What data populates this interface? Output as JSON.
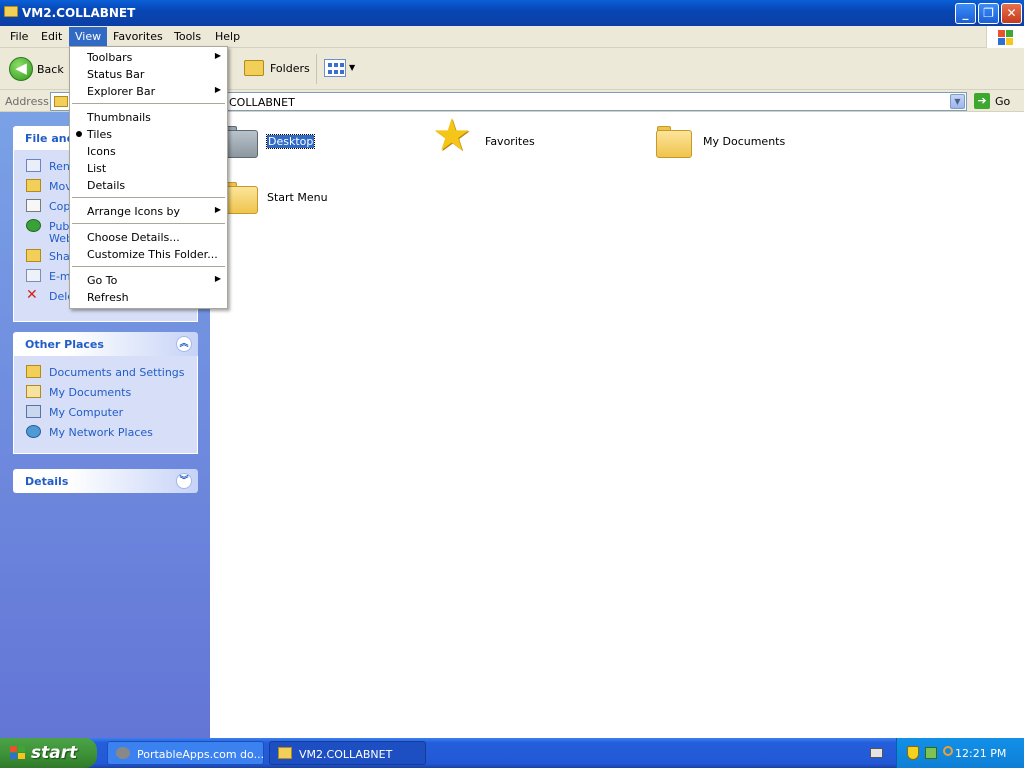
{
  "window": {
    "title": "VM2.COLLABNET",
    "controls": {
      "minimize": "_",
      "maximize": "❐",
      "close": "✕"
    }
  },
  "menubar": {
    "items": [
      "File",
      "Edit",
      "View",
      "Favorites",
      "Tools",
      "Help"
    ],
    "active": "View"
  },
  "toolbar": {
    "back_label": "Back",
    "folders_label": "Folders"
  },
  "address": {
    "label": "Address",
    "value": "COLLABNET",
    "go_label": "Go"
  },
  "view_menu": {
    "items": [
      {
        "label": "Toolbars",
        "submenu": true
      },
      {
        "label": "Status Bar"
      },
      {
        "label": "Explorer Bar",
        "submenu": true
      },
      {
        "label": "Thumbnails"
      },
      {
        "label": "Tiles",
        "checked": true
      },
      {
        "label": "Icons"
      },
      {
        "label": "List"
      },
      {
        "label": "Details"
      },
      {
        "label": "Arrange Icons by",
        "submenu": true
      },
      {
        "label": "Choose Details..."
      },
      {
        "label": "Customize This Folder..."
      },
      {
        "label": "Go To",
        "submenu": true
      },
      {
        "label": "Refresh"
      }
    ]
  },
  "taskpane": {
    "file_tasks": {
      "title": "File and",
      "links": [
        "Ren",
        "Mov",
        "Cop",
        "Publ",
        "Web",
        "Shar",
        "E-m",
        "Dele"
      ]
    },
    "other_places": {
      "title": "Other Places",
      "links": [
        "Documents and Settings",
        "My Documents",
        "My Computer",
        "My Network Places"
      ]
    },
    "details": {
      "title": "Details"
    }
  },
  "content": {
    "items": [
      {
        "label": "Desktop",
        "icon": "desktop-folder-icon",
        "selected": true
      },
      {
        "label": "Favorites",
        "icon": "star-icon"
      },
      {
        "label": "My Documents",
        "icon": "folder-icon"
      },
      {
        "label": "Start Menu",
        "icon": "folder-icon"
      }
    ]
  },
  "taskbar": {
    "start_label": "start",
    "tasks": [
      "PortableApps.com do...",
      "VM2.COLLABNET"
    ],
    "clock": "12:21 PM"
  },
  "colors": {
    "title_bar": "#0846b4",
    "menu_highlight": "#316ac5",
    "taskpane_link": "#215dc6",
    "taskbar": "#245edb",
    "start_button": "#3c8f36"
  }
}
